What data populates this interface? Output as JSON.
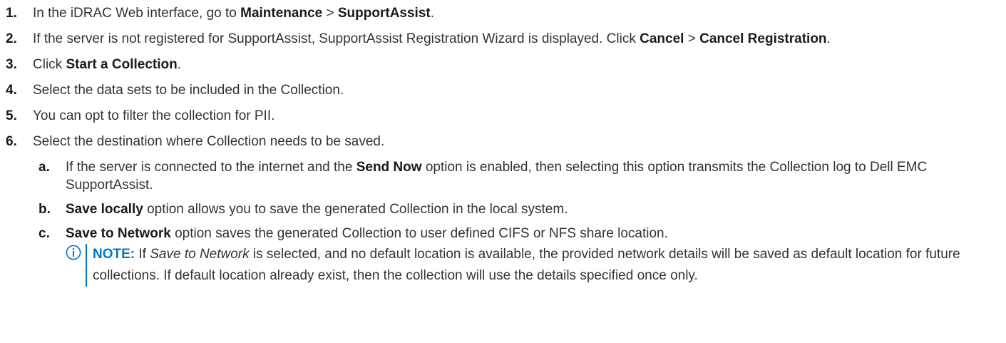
{
  "steps": [
    {
      "num": "1.",
      "t1": "In the iDRAC Web interface, go to ",
      "b1": "Maintenance",
      "t2": " > ",
      "b2": "SupportAssist",
      "t3": "."
    },
    {
      "num": "2.",
      "t1": "If the server is not registered for SupportAssist, SupportAssist Registration Wizard is displayed. Click ",
      "b1": "Cancel",
      "t2": " > ",
      "b2": "Cancel Registration",
      "t3": "."
    },
    {
      "num": "3.",
      "t1": "Click ",
      "b1": "Start a Collection",
      "t2": "."
    },
    {
      "num": "4.",
      "text": "Select the data sets to be included in the Collection."
    },
    {
      "num": "5.",
      "text": "You can opt to filter the collection for PII."
    },
    {
      "num": "6.",
      "text": "Select the destination where Collection needs to be saved."
    }
  ],
  "substeps": [
    {
      "num": "a.",
      "t1": "If the server is connected to the internet and the ",
      "b1": "Send Now",
      "t2": " option is enabled, then selecting this option transmits the Collection log to Dell EMC SupportAssist."
    },
    {
      "num": "b.",
      "b1": "Save locally",
      "t1": " option allows you to save the generated Collection in the local system."
    },
    {
      "num": "c.",
      "b1": "Save to Network",
      "t1": " option saves the generated Collection to user defined CIFS or NFS share location."
    }
  ],
  "note": {
    "label": "NOTE:",
    "t1": " If ",
    "i1": "Save to Network",
    "t2": " is selected, and no default location is available, the provided network details will be saved as default location for future collections. If default location already exist, then the collection will use the details specified once only."
  },
  "colors": {
    "note_accent": "#0076ce",
    "text": "#333333"
  },
  "icons": {
    "note": "info-circle-icon"
  }
}
